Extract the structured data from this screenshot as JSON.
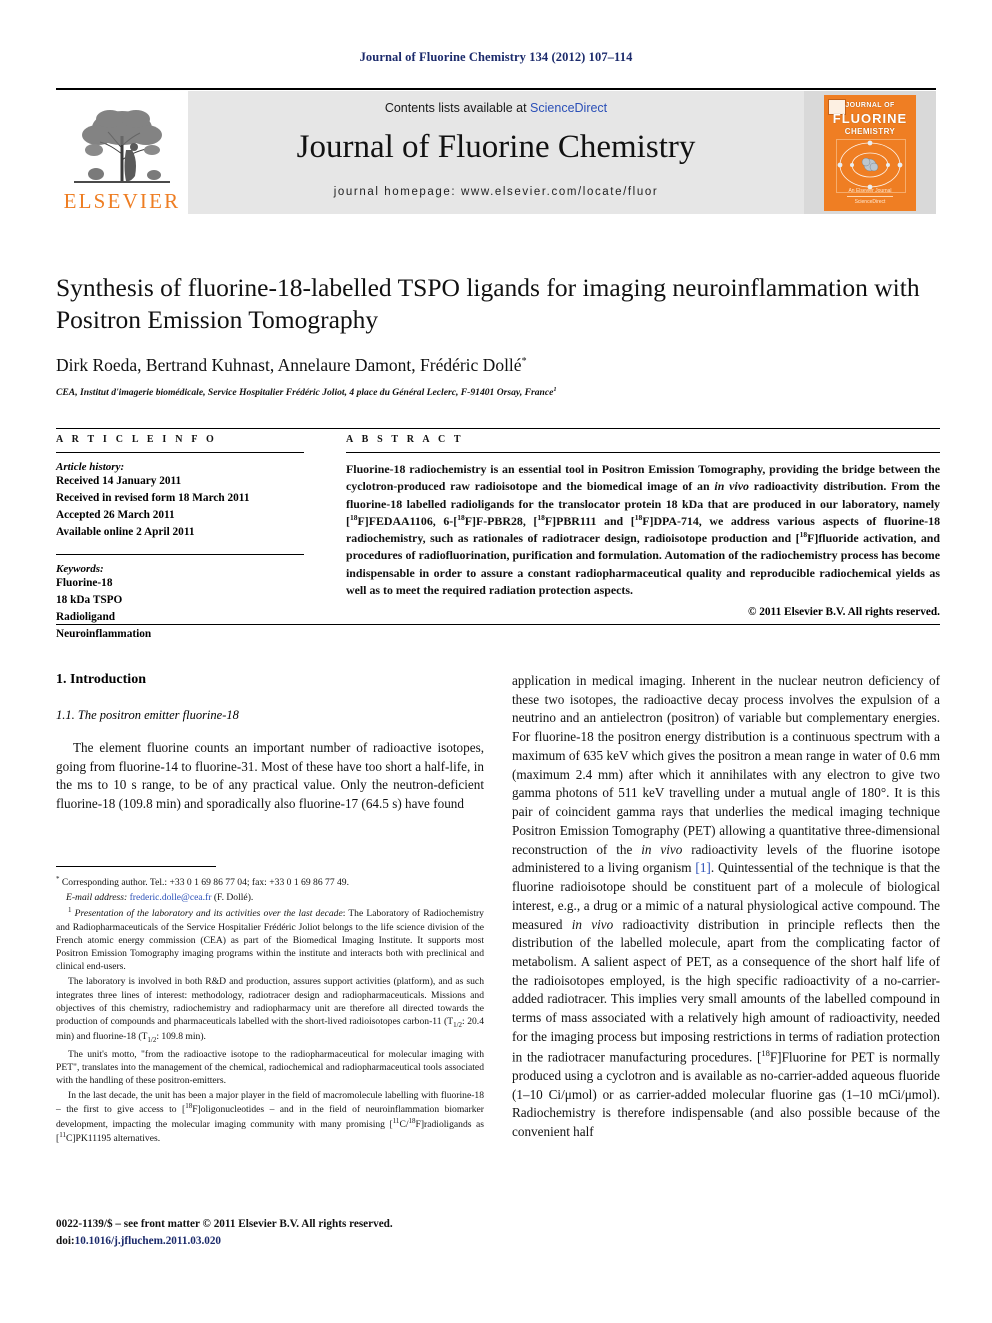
{
  "running_head": "Journal of Fluorine Chemistry 134 (2012) 107–114",
  "masthead": {
    "contents_prefix": "Contents lists available at ",
    "sciencedirect": "ScienceDirect",
    "journal_title": "Journal of Fluorine Chemistry",
    "homepage": "journal homepage: www.elsevier.com/locate/fluor",
    "publisher_wordmark": "ELSEVIER",
    "cover": {
      "line1": "JOURNAL OF",
      "line2": "FLUORINE",
      "line3": "CHEMISTRY",
      "foot1": "An Elsevier Journal",
      "foot2": "ScienceDirect"
    },
    "accent_orange": "#ee7d22",
    "link_blue": "#2a4fb7",
    "band_grey": "#e6e6e6"
  },
  "article": {
    "title": "Synthesis of fluorine-18-labelled TSPO ligands for imaging neuroinflammation with Positron Emission Tomography",
    "authors": "Dirk Roeda, Bertrand Kuhnast, Annelaure Damont, Frédéric Dollé",
    "author_marker": "*",
    "affiliation": "CEA, Institut d'imagerie biomédicale, Service Hospitalier Frédéric Joliot, 4 place du Général Leclerc, F-91401 Orsay, France",
    "affiliation_marker": "1"
  },
  "info": {
    "heading": "A R T I C L E   I N F O",
    "history_label": "Article history:",
    "history": [
      "Received 14 January 2011",
      "Received in revised form 18 March 2011",
      "Accepted 26 March 2011",
      "Available online 2 April 2011"
    ],
    "keywords_label": "Keywords:",
    "keywords": [
      "Fluorine-18",
      "18 kDa TSPO",
      "Radioligand",
      "Neuroinflammation"
    ]
  },
  "abstract": {
    "heading": "A B S T R A C T",
    "copyright": "© 2011 Elsevier B.V. All rights reserved."
  },
  "body": {
    "section_number_title": "1. Introduction",
    "subsection_number_title": "1.1. The positron emitter fluorine-18"
  },
  "footer": {
    "front_matter": "0022-1139/$ – see front matter © 2011 Elsevier B.V. All rights reserved.",
    "doi_label": "doi:",
    "doi": "10.1016/j.jfluchem.2011.03.020"
  }
}
